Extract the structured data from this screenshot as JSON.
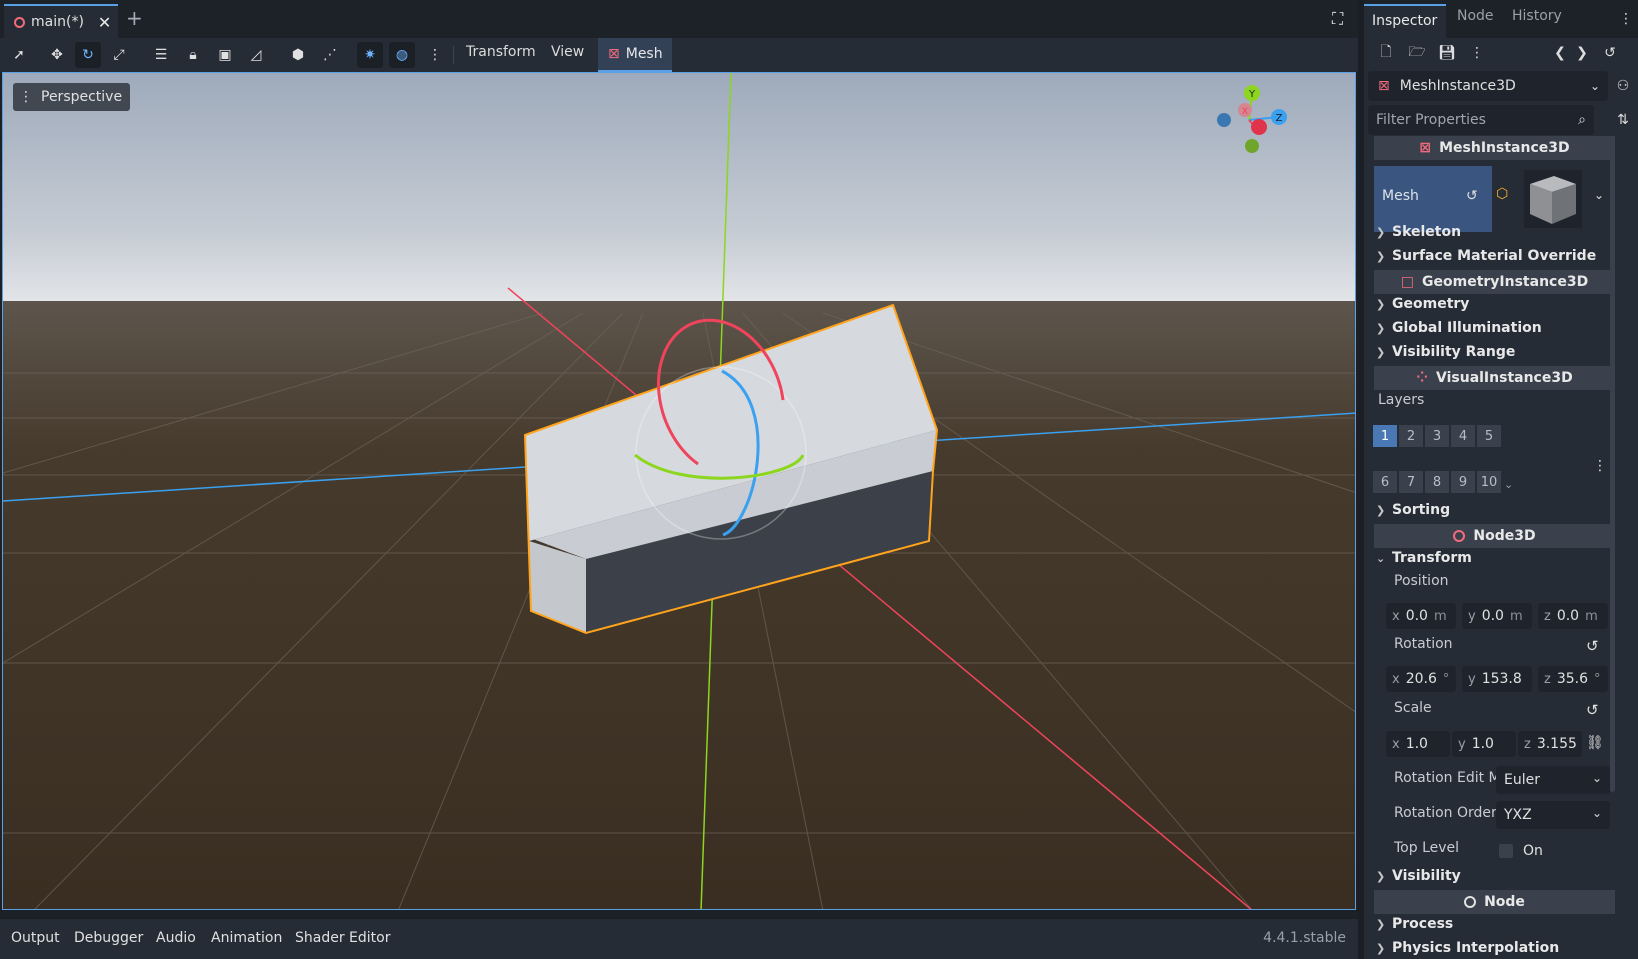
{
  "tab": {
    "title": "main(*)",
    "close": "✕",
    "add": "+"
  },
  "toolbar": {
    "transform": "Transform",
    "view": "View",
    "mesh": "Mesh"
  },
  "viewport": {
    "camera_menu": "Perspective",
    "gizmo_labels": {
      "x": "X",
      "y": "Y",
      "z": "Z"
    }
  },
  "bottom": {
    "tabs": [
      "Output",
      "Debugger",
      "Audio",
      "Animation",
      "Shader Editor"
    ],
    "version": "4.4.1.stable"
  },
  "inspector": {
    "tabs": [
      "Inspector",
      "Node",
      "History"
    ],
    "object": "MeshInstance3D",
    "filter_placeholder": "Filter Properties",
    "sections": {
      "mesh_instance": "MeshInstance3D",
      "geometry_instance": "GeometryInstance3D",
      "visual_instance": "VisualInstance3D",
      "node3d": "Node3D",
      "node": "Node"
    },
    "mesh_label": "Mesh",
    "groups": {
      "skeleton": "Skeleton",
      "surface_material": "Surface Material Override",
      "geometry": "Geometry",
      "gi": "Global Illumination",
      "visibility_range": "Visibility Range",
      "sorting": "Sorting",
      "transform": "Transform",
      "visibility": "Visibility",
      "process": "Process",
      "physics": "Physics Interpolation"
    },
    "layers_label": "Layers",
    "layers": [
      "1",
      "2",
      "3",
      "4",
      "5",
      "6",
      "7",
      "8",
      "9",
      "10"
    ],
    "active_layer": "1",
    "position": {
      "label": "Position",
      "x": "0.0",
      "y": "0.0",
      "z": "0.0",
      "unit": "m"
    },
    "rotation": {
      "label": "Rotation",
      "x": "20.6",
      "y": "153.8",
      "z": "35.6",
      "unit": "°"
    },
    "scale": {
      "label": "Scale",
      "x": "1.0",
      "y": "1.0",
      "z": "3.155"
    },
    "rotation_edit_mode": {
      "label": "Rotation Edit M",
      "value": "Euler"
    },
    "rotation_order": {
      "label": "Rotation Order",
      "value": "YXZ"
    },
    "top_level": {
      "label": "Top Level",
      "value": "On"
    }
  },
  "colors": {
    "accent": "#5aa0e6",
    "x_axis": "#f0445c",
    "y_axis": "#8cd61e",
    "z_axis": "#3aa0f0",
    "selection": "#ffa41c"
  }
}
